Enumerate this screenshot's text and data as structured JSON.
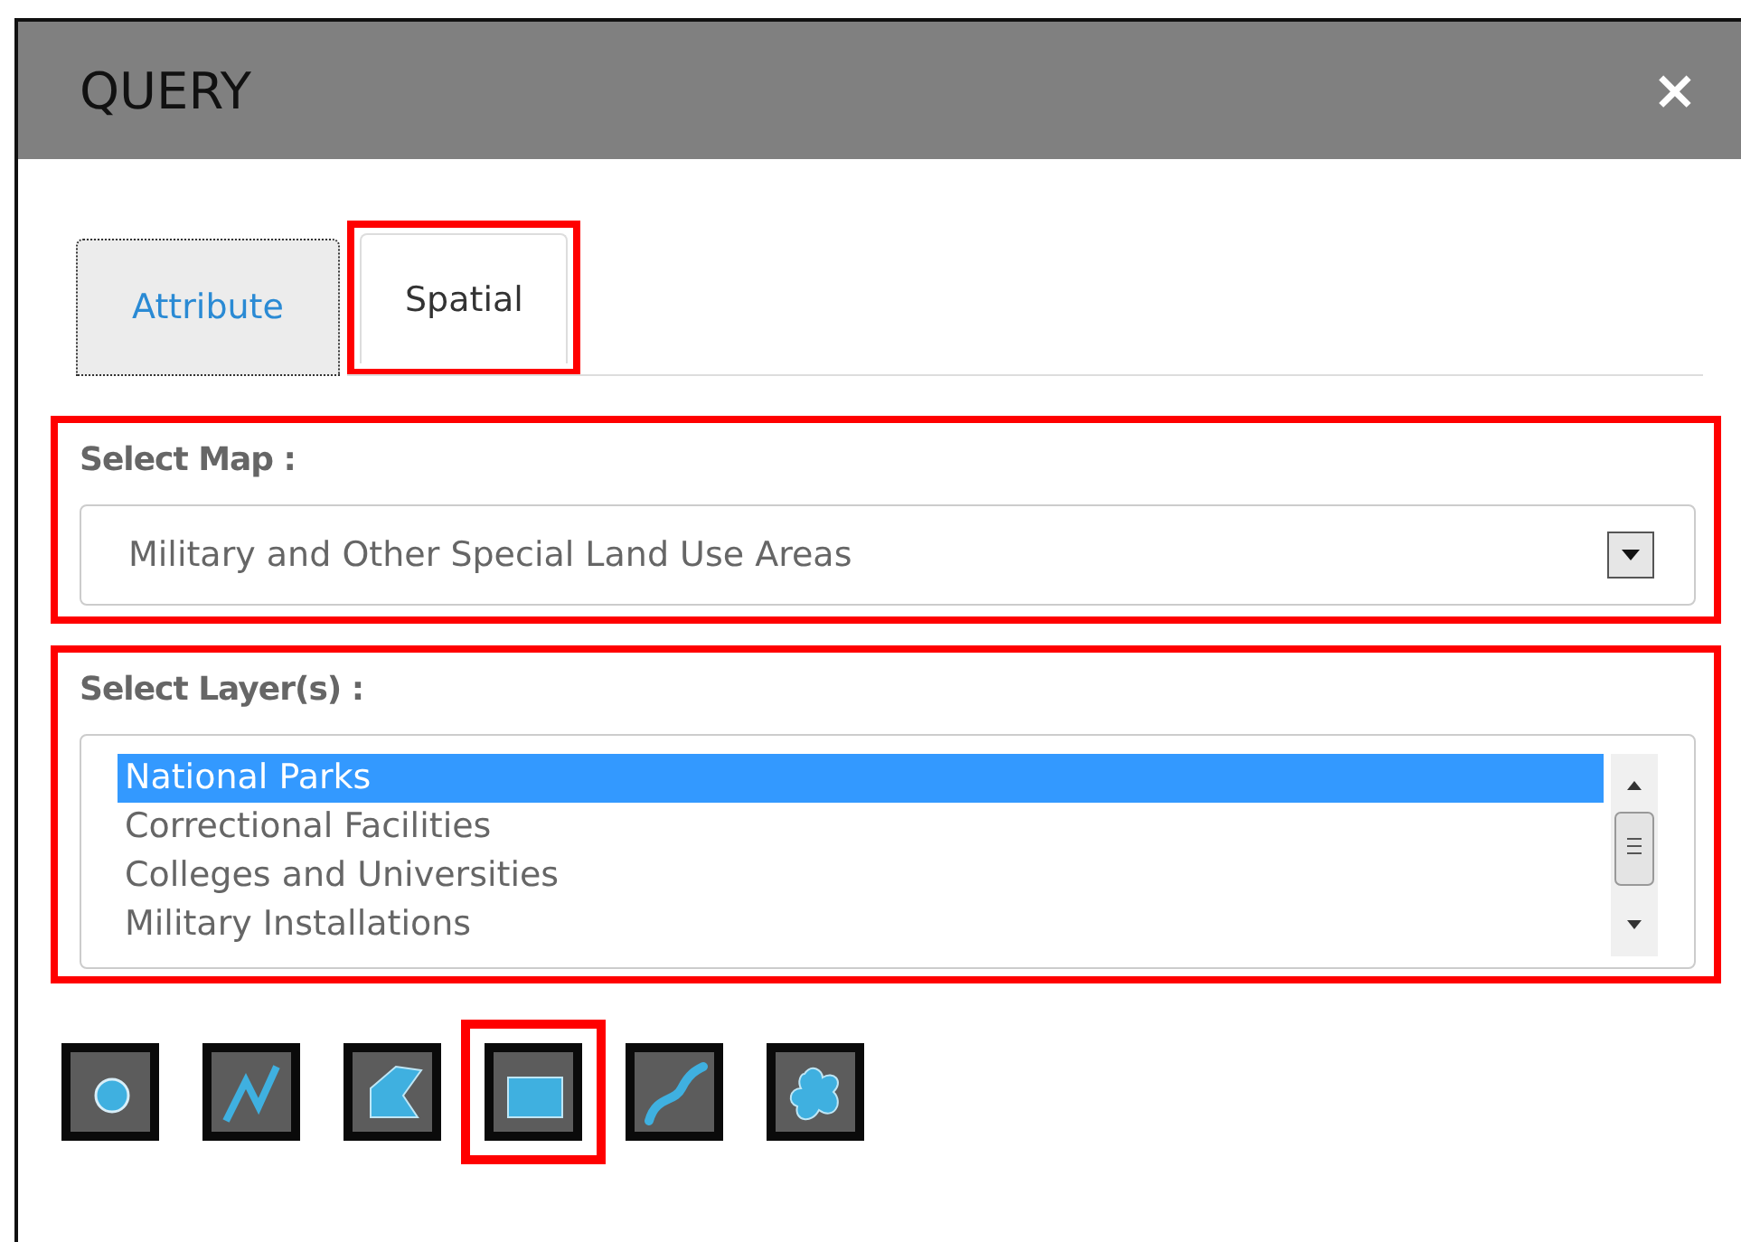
{
  "window": {
    "title": "QUERY",
    "close": "×"
  },
  "tabs": [
    {
      "label": "Attribute",
      "selected": false,
      "highlighted": false
    },
    {
      "label": "Spatial",
      "selected": true,
      "highlighted": true
    }
  ],
  "map_section": {
    "label": "Select Map :",
    "value": "Military and Other Special Land Use Areas",
    "highlighted": true
  },
  "layer_section": {
    "label": "Select Layer(s) :",
    "highlighted": true,
    "items": [
      {
        "label": "National Parks",
        "selected": true
      },
      {
        "label": "Correctional Facilities",
        "selected": false
      },
      {
        "label": "Colleges and Universities",
        "selected": false
      },
      {
        "label": "Military Installations",
        "selected": false
      }
    ]
  },
  "tools": [
    {
      "kind": "point",
      "highlighted": false
    },
    {
      "kind": "polyline",
      "highlighted": false
    },
    {
      "kind": "polygon",
      "highlighted": false
    },
    {
      "kind": "rectangle",
      "highlighted": true
    },
    {
      "kind": "freehand-line",
      "highlighted": false
    },
    {
      "kind": "freehand-polygon",
      "highlighted": false
    }
  ]
}
